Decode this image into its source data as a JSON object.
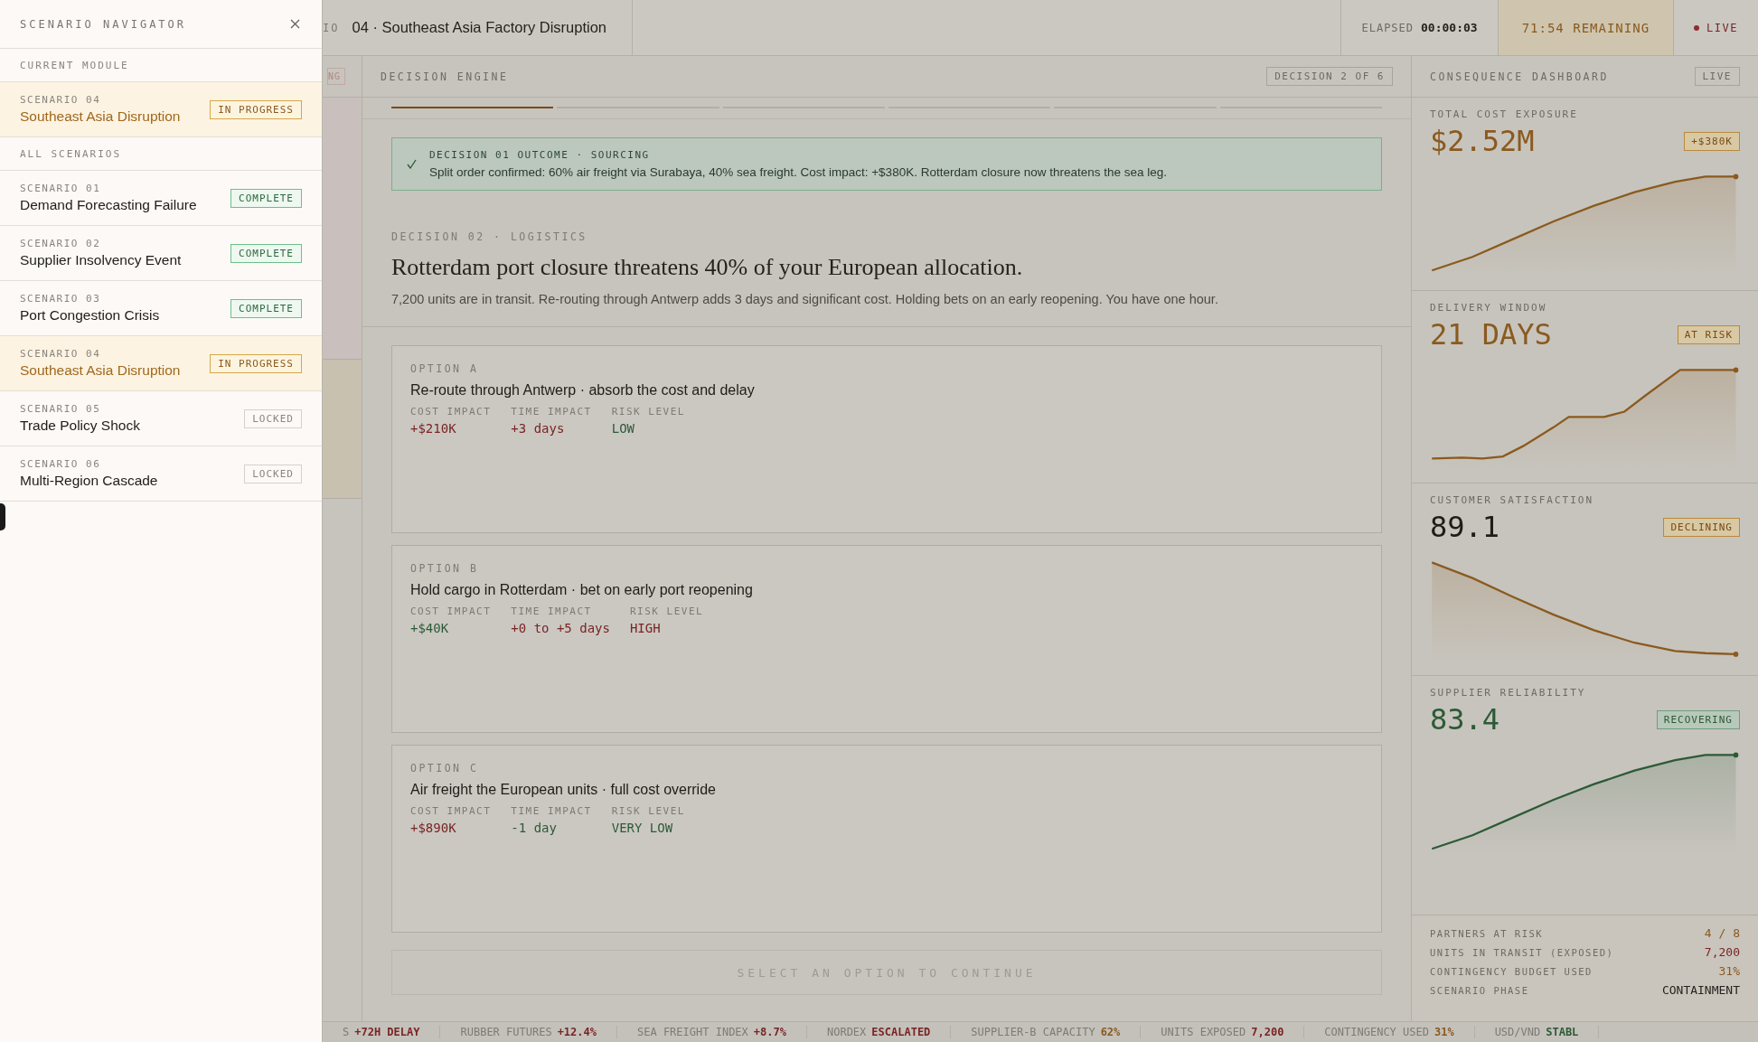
{
  "navigator": {
    "title": "SCENARIO NAVIGATOR",
    "current_label": "CURRENT MODULE",
    "current": {
      "number": "SCENARIO 04",
      "name": "Southeast Asia Disruption",
      "status": "IN PROGRESS",
      "kind": "in_progress"
    },
    "all_label": "ALL SCENARIOS",
    "items": [
      {
        "number": "SCENARIO 01",
        "name": "Demand Forecasting Failure",
        "status": "COMPLETE",
        "kind": "complete",
        "selected": false
      },
      {
        "number": "SCENARIO 02",
        "name": "Supplier Insolvency Event",
        "status": "COMPLETE",
        "kind": "complete",
        "selected": false
      },
      {
        "number": "SCENARIO 03",
        "name": "Port Congestion Crisis",
        "status": "COMPLETE",
        "kind": "complete",
        "selected": false
      },
      {
        "number": "SCENARIO 04",
        "name": "Southeast Asia Disruption",
        "status": "IN PROGRESS",
        "kind": "in_progress",
        "selected": true
      },
      {
        "number": "SCENARIO 05",
        "name": "Trade Policy Shock",
        "status": "LOCKED",
        "kind": "locked",
        "selected": false
      },
      {
        "number": "SCENARIO 06",
        "name": "Multi-Region Cascade",
        "status": "LOCKED",
        "kind": "locked",
        "selected": false
      }
    ]
  },
  "header": {
    "cut_label": "IO",
    "title": "04 · Southeast Asia Factory Disruption",
    "elapsed_label": "ELAPSED",
    "elapsed": "00:00:03",
    "remaining": "71:54 REMAINING",
    "live": "LIVE"
  },
  "side_tag": "NG",
  "engine": {
    "title": "DECISION ENGINE",
    "counter": "DECISION 2 OF 6",
    "steps": [
      {
        "done": true
      },
      {
        "done": false
      },
      {
        "done": false
      },
      {
        "done": false
      },
      {
        "done": false
      },
      {
        "done": false
      }
    ],
    "outcome": {
      "label": "DECISION 01 OUTCOME · SOURCING",
      "text": "Split order confirmed: 60% air freight via Surabaya, 40% sea freight. Cost impact: +$380K. Rotterdam closure now threatens the sea leg."
    },
    "decision_label": "DECISION 02 · LOGISTICS",
    "question": "Rotterdam port closure threatens 40% of your European allocation.",
    "description": "7,200 units are in transit. Re-routing through Antwerp adds 3 days and significant cost. Holding bets on an early reopening. You have one hour.",
    "options": [
      {
        "label": "OPTION A",
        "title": "Re-route through Antwerp · absorb the cost and delay",
        "metrics": [
          {
            "label": "COST IMPACT",
            "value": "+$210K",
            "color": "#7a2424"
          },
          {
            "label": "TIME IMPACT",
            "value": "+3 days",
            "color": "#7a2424"
          },
          {
            "label": "RISK LEVEL",
            "value": "LOW",
            "color": "#2c5a36"
          }
        ]
      },
      {
        "label": "OPTION B",
        "title": "Hold cargo in Rotterdam · bet on early port reopening",
        "metrics": [
          {
            "label": "COST IMPACT",
            "value": "+$40K",
            "color": "#2c5a36"
          },
          {
            "label": "TIME IMPACT",
            "value": "+0 to +5 days",
            "color": "#7a2424"
          },
          {
            "label": "RISK LEVEL",
            "value": "HIGH",
            "color": "#7a2424"
          }
        ]
      },
      {
        "label": "OPTION C",
        "title": "Air freight the European units · full cost override",
        "metrics": [
          {
            "label": "COST IMPACT",
            "value": "+$890K",
            "color": "#7a2424"
          },
          {
            "label": "TIME IMPACT",
            "value": "-1 day",
            "color": "#2c5a36"
          },
          {
            "label": "RISK LEVEL",
            "value": "VERY LOW",
            "color": "#2c5a36"
          }
        ]
      }
    ],
    "continue_button": {
      "label": "SELECT AN OPTION TO CONTINUE",
      "disabled": true
    }
  },
  "dashboard": {
    "title": "CONSEQUENCE DASHBOARD",
    "badge": "LIVE",
    "metrics": [
      {
        "label": "TOTAL COST EXPOSURE",
        "value": "$2.52M",
        "badge": "+$380K",
        "kind": "warning"
      },
      {
        "label": "DELIVERY WINDOW",
        "value": "21 DAYS",
        "badge": "AT RISK",
        "kind": "warning"
      },
      {
        "label": "CUSTOMER SATISFACTION",
        "value": "89.1",
        "badge": "DECLINING",
        "kind": "neutral"
      },
      {
        "label": "SUPPLIER RELIABILITY",
        "value": "83.4",
        "badge": "RECOVERING",
        "kind": "positive"
      }
    ],
    "stats": [
      {
        "label": "PARTNERS AT RISK",
        "value": "4 / 8",
        "color": "#8a5a1f"
      },
      {
        "label": "UNITS IN TRANSIT (EXPOSED)",
        "value": "7,200",
        "color": "#7a2424"
      },
      {
        "label": "CONTINGENCY BUDGET USED",
        "value": "31%",
        "color": "#8a5a1f"
      },
      {
        "label": "SCENARIO PHASE",
        "value": "CONTAINMENT",
        "color": "#26231f"
      }
    ]
  },
  "ticker": [
    {
      "label": "S",
      "value": "+72H DELAY",
      "color": "#7a2424"
    },
    {
      "label": "RUBBER FUTURES",
      "value": "+12.4%",
      "color": "#7a2424"
    },
    {
      "label": "SEA FREIGHT INDEX",
      "value": "+8.7%",
      "color": "#7a2424"
    },
    {
      "label": "NORDEX",
      "value": "ESCALATED",
      "color": "#7a2424"
    },
    {
      "label": "SUPPLIER-B CAPACITY",
      "value": "62%",
      "color": "#8a5a1f"
    },
    {
      "label": "UNITS EXPOSED",
      "value": "7,200",
      "color": "#7a2424"
    },
    {
      "label": "CONTINGENCY USED",
      "value": "31%",
      "color": "#8a5a1f"
    },
    {
      "label": "USD/VND",
      "value": "STABL",
      "color": "#2c5a36"
    }
  ]
}
